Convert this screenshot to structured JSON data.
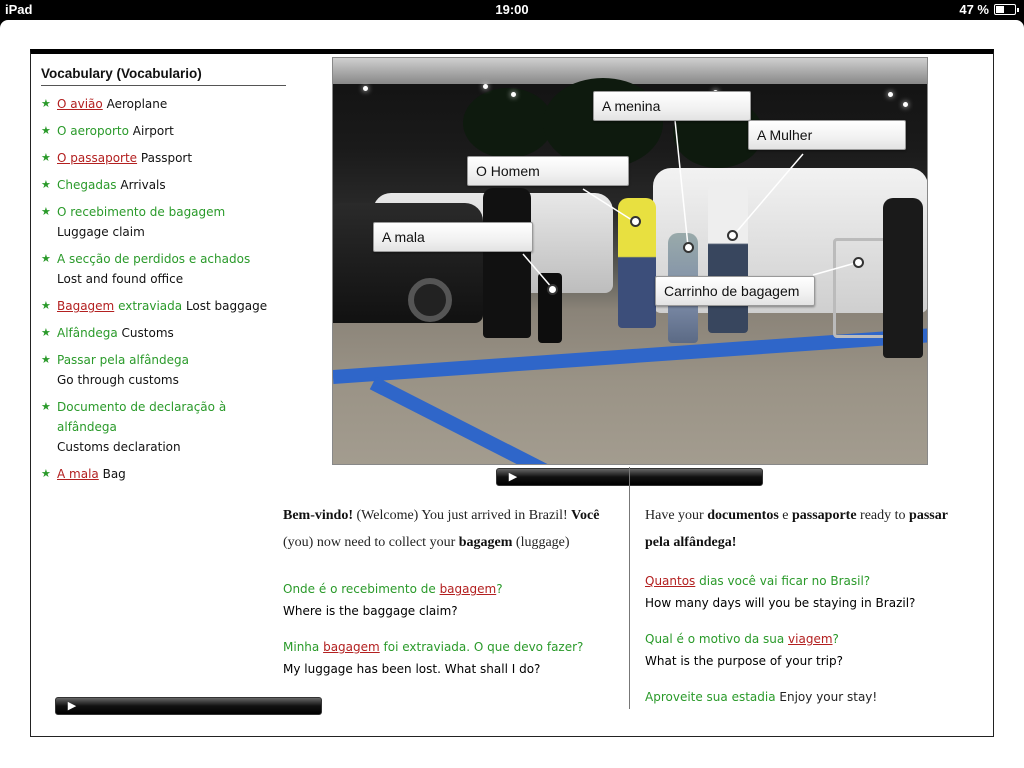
{
  "status_bar": {
    "device": "iPad",
    "time": "19:00",
    "battery": "47 %",
    "battery_level": 0.47
  },
  "vocab": {
    "title": "Vocabulary (Vocabulario)",
    "items": [
      {
        "pt": "O avião",
        "en": "Aeroplane",
        "red": true
      },
      {
        "pt": "O aeroporto",
        "en": "Airport",
        "red": false
      },
      {
        "pt": "O passaporte",
        "en": "Passport",
        "red": true
      },
      {
        "pt": "Chegadas",
        "en": "Arrivals",
        "red": false
      },
      {
        "pt": "O recebimento de bagagem",
        "en": "Luggage claim",
        "red": false
      },
      {
        "pt": "A secção de perdidos e achados",
        "en": "Lost and found office",
        "red": false
      },
      {
        "pt": "Bagagem",
        "pt2": "extraviada",
        "en": "Lost baggage",
        "red": true
      },
      {
        "pt": "Alfândega",
        "en": "Customs",
        "red": false
      },
      {
        "pt": "Passar pela alfândega",
        "en": "Go through customs",
        "red": false
      },
      {
        "pt": "Documento de declaração à alfândega",
        "en": "Customs declaration",
        "red": false
      },
      {
        "pt": "A mala",
        "en": "Bag",
        "red": true
      }
    ]
  },
  "photo_tags": {
    "menina": "A menina",
    "mulher": "A Mulher",
    "homem": "O Homem",
    "mala": "A mala",
    "carrinho": "Carrinho de bagagem"
  },
  "text_left": {
    "p1_a": "Bem-vindo!",
    "p1_b": " (Welcome) You just arrived in Brazil! ",
    "p1_c": "Você",
    "p2_a": "(you) now need to collect your ",
    "p2_b": "bagagem",
    "p2_c": " (luggage)",
    "q1_a": "Onde é o recebimento de ",
    "q1_b": "bagagem",
    "q1_c": "?",
    "q1_en": "Where is the baggage claim?",
    "q2_a": "Minha ",
    "q2_b": "bagagem",
    "q2_c": " foi extraviada. O que devo fazer?",
    "q2_en": "My luggage has been lost. What shall I do?"
  },
  "text_right": {
    "p1_a": "Have your ",
    "p1_b": "documentos",
    "p1_c": " e ",
    "p1_d": "passaporte",
    "p1_e": " ready to ",
    "p1_f": "passar",
    "p2": "pela alfândega!",
    "q1_a": "Quantos",
    "q1_b": " dias você vai ficar no Brasil?",
    "q1_en": "How many days will you be staying in Brazil?",
    "q2_a": "Qual é o motivo da sua ",
    "q2_b": "viagem",
    "q2_c": "?",
    "q2_en": "What is the purpose of your trip?",
    "q3_a": "Aproveite sua estadia",
    "q3_en": " Enjoy your stay!"
  },
  "players": {
    "play_glyph": "▶"
  }
}
